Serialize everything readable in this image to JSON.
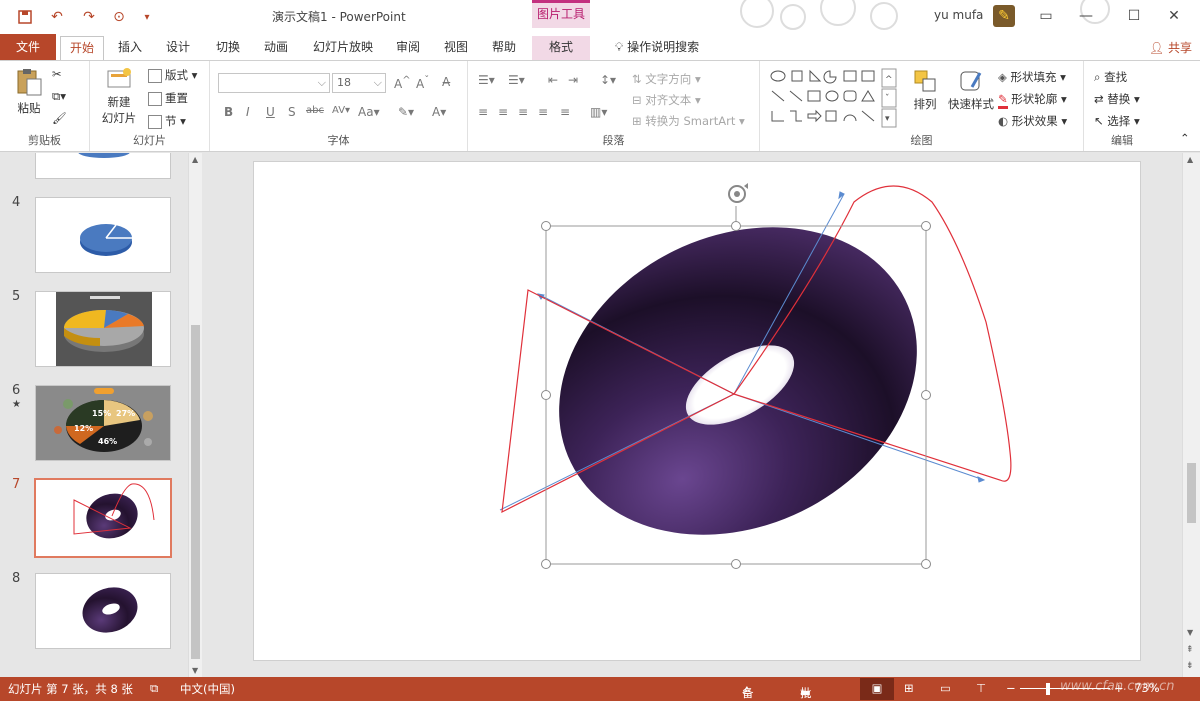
{
  "titlebar": {
    "doc_title": "演示文稿1  -  PowerPoint",
    "context_tab": "图片工具",
    "user_name": "yu mufa"
  },
  "tabs": [
    "文件",
    "开始",
    "插入",
    "设计",
    "切换",
    "动画",
    "幻灯片放映",
    "审阅",
    "视图",
    "帮助",
    "格式"
  ],
  "tell_me": "操作说明搜索",
  "share": "共享",
  "ribbon": {
    "clipboard": {
      "paste": "粘贴",
      "label": "剪贴板"
    },
    "slides": {
      "new_slide": "新建",
      "new_slide2": "幻灯片",
      "layout": "版式",
      "reset": "重置",
      "section": "节",
      "label": "幻灯片"
    },
    "font": {
      "font_name": "",
      "font_size": "18",
      "label": "字体"
    },
    "paragraph": {
      "text_direction": "文字方向",
      "align_text": "对齐文本",
      "smartart": "转换为 SmartArt",
      "label": "段落"
    },
    "drawing": {
      "arrange": "排列",
      "quick_styles": "快速样式",
      "fill": "形状填充",
      "outline": "形状轮廓",
      "effects": "形状效果",
      "label": "绘图"
    },
    "editing": {
      "find": "查找",
      "replace": "替换",
      "select": "选择",
      "label": "编辑"
    }
  },
  "thumbnails": [
    {
      "num": "4",
      "star": ""
    },
    {
      "num": "5",
      "star": ""
    },
    {
      "num": "6",
      "star": "★"
    },
    {
      "num": "7",
      "star": ""
    },
    {
      "num": "8",
      "star": ""
    }
  ],
  "thumb6_labels": {
    "a": "15%",
    "b": "27%",
    "c": "12%",
    "d": "46%"
  },
  "status": {
    "slide_info": "幻灯片 第 7 张，共 8 张",
    "language": "中文(中国)",
    "notes": "备注",
    "comments": "批注",
    "zoom": "73%",
    "watermark": "www.cfan.com.cn"
  },
  "colors": {
    "accent": "#b7472a",
    "torus": "#3a2150",
    "curve": "#e0303a"
  }
}
